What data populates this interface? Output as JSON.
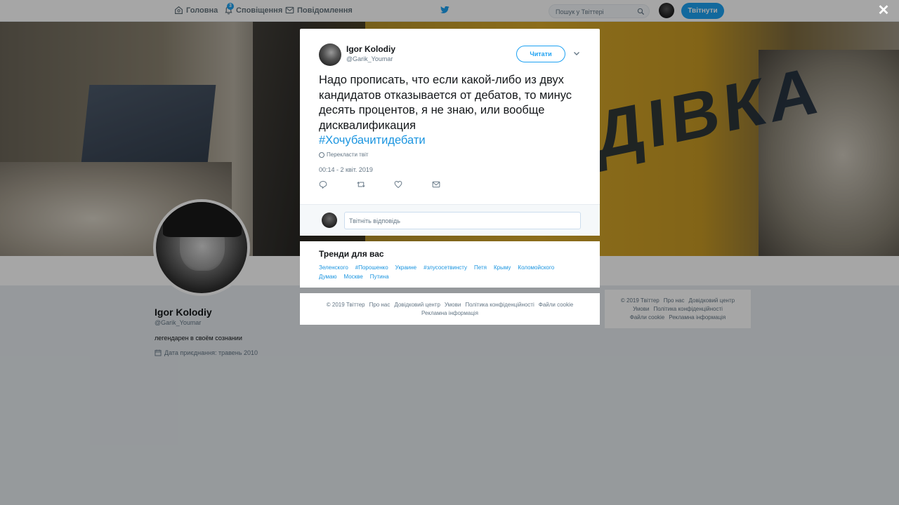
{
  "nav": {
    "home": "Головна",
    "notifications": "Сповіщення",
    "notifications_badge": "3",
    "messages": "Повідомлення",
    "search_placeholder": "Пошук у Твіттері",
    "tweet_button": "Твітнути"
  },
  "profile": {
    "name": "Igor Kolodiy",
    "handle": "@Garik_Youmar",
    "bio": "легендарен в своём сознании",
    "joined": "Дата приєднання: травень 2010"
  },
  "banner": {
    "sign_text": "ДІВКА"
  },
  "tweet": {
    "author_name": "Igor Kolodiy",
    "author_handle": "@Garik_Youmar",
    "follow_label": "Читати",
    "text": "Надо прописать, что если какой-либо из двух кандидатов отказывается от дебатов, то минус десять процентов, я не знаю, или вообще дисквалификация",
    "hashtag": "#Хочубачитидебати",
    "translate": "Перекласти твіт",
    "timestamp": "00:14 - 2 квіт. 2019",
    "reply_placeholder": "Твітніть відповідь"
  },
  "trends": {
    "title": "Тренди для вас",
    "items": [
      "Зеленского",
      "#Порошенко",
      "Украине",
      "#злусосетвинсту",
      "Петя",
      "Крыму",
      "Коломойского",
      "Думаю",
      "Москве",
      "Путина"
    ]
  },
  "footer": {
    "links": [
      "© 2019 Твіттер",
      "Про нас",
      "Довідковий центр",
      "Умови",
      "Політика конфіденційності",
      "Файли cookie",
      "Рекламна інформація"
    ]
  },
  "colors": {
    "accent": "#1da1f2",
    "link": "#1b95e0",
    "muted": "#657786"
  }
}
